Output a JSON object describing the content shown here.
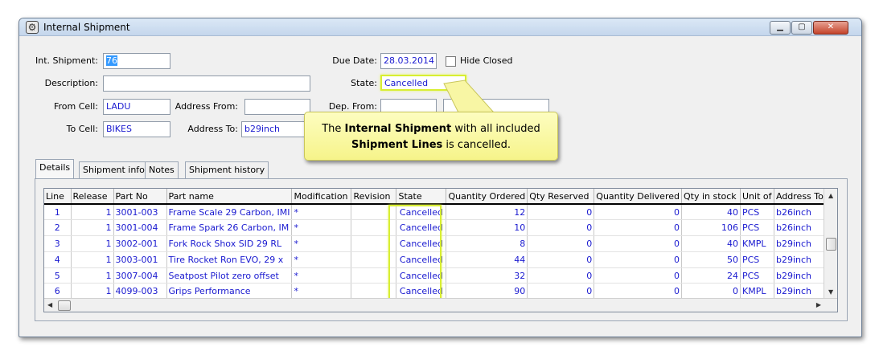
{
  "window": {
    "title": "Internal Shipment"
  },
  "form": {
    "int_shipment_label": "Int. Shipment:",
    "int_shipment_value": "76",
    "due_date_label": "Due Date:",
    "due_date_value": "28.03.2014",
    "hide_closed_label": "Hide Closed",
    "description_label": "Description:",
    "description_value": "",
    "state_label": "State:",
    "state_value": "Cancelled",
    "from_cell_label": "From Cell:",
    "from_cell_value": "LADU",
    "address_from_label": "Address From:",
    "address_from_value": "",
    "dep_from_label": "Dep. From:",
    "to_cell_label": "To Cell:",
    "to_cell_value": "BIKES",
    "address_to_label": "Address To:",
    "address_to_value": "b29inch"
  },
  "tabs": [
    "Details",
    "Shipment info",
    "Notes",
    "Shipment history"
  ],
  "grid": {
    "columns": [
      "Line",
      "Release",
      "Part No",
      "Part name",
      "Modification",
      "Revision",
      "State",
      "Quantity Ordered",
      "Qty Reserved",
      "Quantity Delivered",
      "Qty in stock",
      "Unit of",
      "Address To"
    ],
    "rows": [
      [
        "1",
        "1",
        "3001-003",
        "Frame Scale 29 Carbon, IMI",
        "*",
        "",
        "Cancelled",
        "12",
        "0",
        "0",
        "40",
        "PCS",
        "b26inch"
      ],
      [
        "2",
        "1",
        "3001-004",
        "Frame Spark 26 Carbon, IM",
        "*",
        "",
        "Cancelled",
        "10",
        "0",
        "0",
        "106",
        "PCS",
        "b26inch"
      ],
      [
        "3",
        "1",
        "3002-001",
        "Fork Rock Shox SID 29 RL",
        "*",
        "",
        "Cancelled",
        "8",
        "0",
        "0",
        "40",
        "KMPL",
        "b29inch"
      ],
      [
        "4",
        "1",
        "3003-001",
        "Tire Rocket Ron EVO, 29 x",
        "*",
        "",
        "Cancelled",
        "44",
        "0",
        "0",
        "50",
        "PCS",
        "b29inch"
      ],
      [
        "5",
        "1",
        "3007-004",
        "Seatpost Pilot zero offset",
        "*",
        "",
        "Cancelled",
        "32",
        "0",
        "0",
        "24",
        "PCS",
        "b29inch"
      ],
      [
        "6",
        "1",
        "4099-003",
        "Grips Performance",
        "*",
        "",
        "Cancelled",
        "90",
        "0",
        "0",
        "0",
        "KMPL",
        "b29inch"
      ]
    ]
  },
  "callout": {
    "part1": "The ",
    "bold1": "Internal Shipment",
    "part2": " with all included",
    "bold2": "Shipment Lines",
    "part3": " is cancelled."
  },
  "colors": {
    "value_text": "#1a1ad0",
    "highlight": "#d8ee32",
    "callout_bg": "#f6f48a"
  }
}
